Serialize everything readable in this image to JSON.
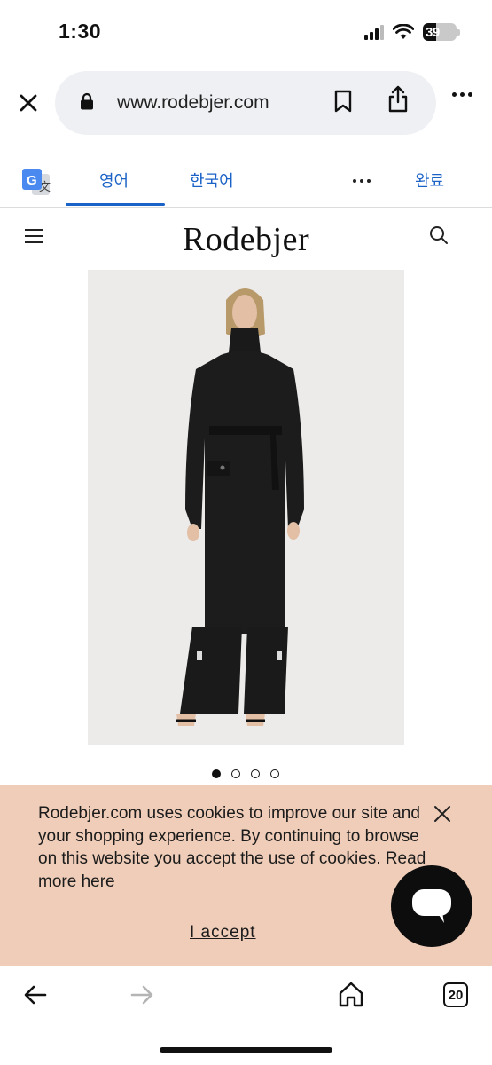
{
  "status_bar": {
    "time": "1:30",
    "battery_level": "39",
    "battery_percent": 39
  },
  "browser": {
    "url": "www.rodebjer.com",
    "icons": [
      "close-icon",
      "lock-icon",
      "bookmark-icon",
      "share-icon",
      "more-icon"
    ]
  },
  "translate": {
    "logo_letter": "G",
    "tab_source": "영어",
    "tab_target": "한국어",
    "done_label": "완료",
    "accent": "#1a62c7"
  },
  "site": {
    "logo": "Rodebjer",
    "icons": [
      "menu-icon",
      "search-icon"
    ]
  },
  "carousel": {
    "total": 4,
    "active": 1
  },
  "cookie": {
    "text": "Rodebjer.com uses cookies to improve our site and your shopping experience. By continuing to browse on this website you accept the use of cookies. Read more",
    "link_label": "here",
    "accept_label": "I accept",
    "background": "#efcdb8"
  },
  "toolbar": {
    "tabs_count": "20",
    "icons": [
      "back-arrow-icon",
      "forward-arrow-icon",
      "home-icon",
      "tabs-icon"
    ]
  }
}
